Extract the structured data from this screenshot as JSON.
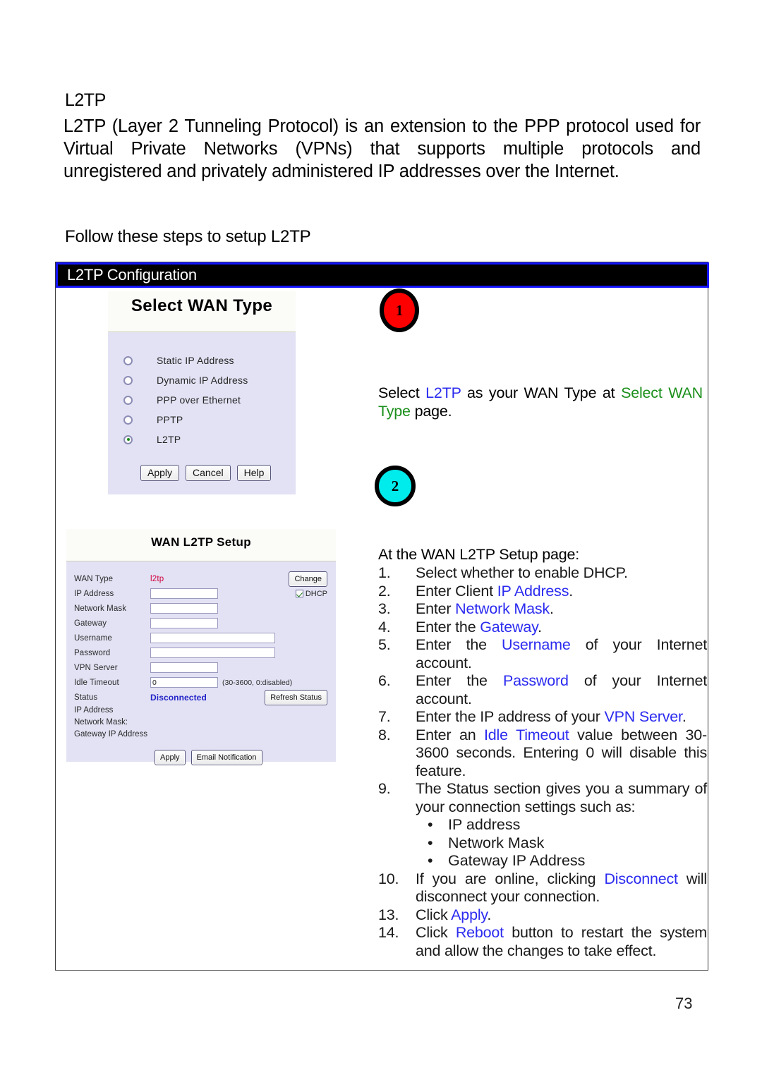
{
  "document": {
    "section_title": "L2TP",
    "intro_paragraph": "L2TP (Layer 2 Tunneling Protocol) is an extension to the PPP protocol used for Virtual Private Networks (VPNs) that supports multiple protocols and unregistered and privately administered IP addresses over the Internet.",
    "follow_line": "Follow these steps to setup L2TP",
    "page_number": "73"
  },
  "config_box": {
    "header_title": "L2TP Configuration",
    "header_bg": "#000000",
    "header_border": "#1414ff"
  },
  "badges": {
    "one": {
      "label": "1",
      "color": "#ff0000"
    },
    "two": {
      "label": "2",
      "color": "#00ecec"
    }
  },
  "wan_type_panel": {
    "title": "Select WAN Type",
    "options": [
      {
        "label": "Static IP Address",
        "selected": false
      },
      {
        "label": "Dynamic IP Address",
        "selected": false
      },
      {
        "label": "PPP over Ethernet",
        "selected": false
      },
      {
        "label": "PPTP",
        "selected": false
      },
      {
        "label": "L2TP",
        "selected": true
      }
    ],
    "buttons": [
      "Apply",
      "Cancel",
      "Help"
    ]
  },
  "l2tp_setup_panel": {
    "title": "WAN L2TP Setup",
    "rows": {
      "wan_type_label": "WAN Type",
      "wan_type_value": "l2tp",
      "change_button": "Change",
      "ip_address_label": "IP Address",
      "ip_address_value": "",
      "dhcp_label": "DHCP",
      "dhcp_checked": true,
      "network_mask_label": "Network Mask",
      "network_mask_value": "",
      "gateway_label": "Gateway",
      "gateway_value": "",
      "username_label": "Username",
      "username_value": "",
      "password_label": "Password",
      "password_value": "",
      "vpn_server_label": "VPN Server",
      "vpn_server_value": "",
      "idle_timeout_label": "Idle Timeout",
      "idle_timeout_value": "0",
      "idle_timeout_hint": "(30-3600, 0:disabled)",
      "status_label": "Status",
      "status_value": "Disconnected",
      "refresh_button": "Refresh Status",
      "status_ip_address_label": "IP Address",
      "status_network_mask_label": "Network Mask:",
      "status_gateway_label": "Gateway IP Address"
    },
    "buttons": {
      "apply": "Apply",
      "email_notification": "Email Notification"
    }
  },
  "step1": {
    "text_a": "Select ",
    "hl_l2tp": "L2TP",
    "text_b": " as your WAN Type at ",
    "hl_page": "Select WAN Type",
    "text_c": " page."
  },
  "step2": {
    "intro": "At the WAN L2TP Setup page:",
    "items": [
      {
        "num": "1.",
        "parts": [
          {
            "t": "Select whether to enable DHCP."
          }
        ]
      },
      {
        "num": "2.",
        "parts": [
          {
            "t": "Enter Client "
          },
          {
            "t": "IP Address",
            "c": "blue"
          },
          {
            "t": "."
          }
        ]
      },
      {
        "num": "3.",
        "parts": [
          {
            "t": "Enter "
          },
          {
            "t": "Network Mask",
            "c": "blue"
          },
          {
            "t": "."
          }
        ]
      },
      {
        "num": "4.",
        "parts": [
          {
            "t": "Enter the "
          },
          {
            "t": "Gateway",
            "c": "blue"
          },
          {
            "t": "."
          }
        ]
      },
      {
        "num": "5.",
        "parts": [
          {
            "t": "Enter the "
          },
          {
            "t": "Username",
            "c": "blue"
          },
          {
            "t": " of your Internet account."
          }
        ]
      },
      {
        "num": "6.",
        "parts": [
          {
            "t": "Enter the "
          },
          {
            "t": "Password",
            "c": "blue"
          },
          {
            "t": " of your Internet account."
          }
        ]
      },
      {
        "num": "7.",
        "parts": [
          {
            "t": "Enter the IP address of your "
          },
          {
            "t": "VPN Server",
            "c": "blue"
          },
          {
            "t": "."
          }
        ]
      },
      {
        "num": "8.",
        "parts": [
          {
            "t": "Enter an "
          },
          {
            "t": "Idle Timeout",
            "c": "blue"
          },
          {
            "t": " value between 30-3600 seconds. Entering 0 will disable this feature."
          }
        ]
      },
      {
        "num": "9.",
        "parts": [
          {
            "t": "The Status section gives you a summary of your connection settings such as:"
          }
        ],
        "bullets": [
          "IP address",
          "Network Mask",
          "Gateway IP Address"
        ]
      },
      {
        "num": "10.",
        "parts": [
          {
            "t": "If you are online, clicking "
          },
          {
            "t": "Disconnect",
            "c": "blue"
          },
          {
            "t": " will disconnect your connection."
          }
        ]
      },
      {
        "num": "13.",
        "parts": [
          {
            "t": "Click "
          },
          {
            "t": "Apply",
            "c": "blue"
          },
          {
            "t": "."
          }
        ]
      },
      {
        "num": "14.",
        "parts": [
          {
            "t": "Click "
          },
          {
            "t": "Reboot",
            "c": "blue"
          },
          {
            "t": " button to restart the system and allow the changes to take effect."
          }
        ]
      }
    ]
  }
}
